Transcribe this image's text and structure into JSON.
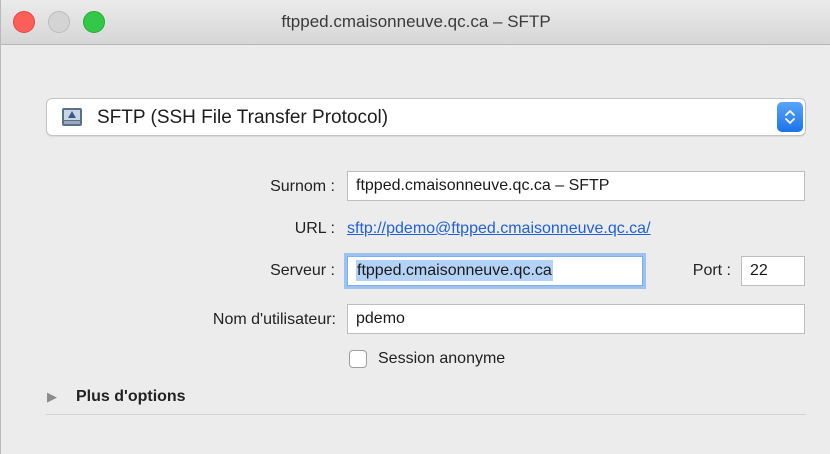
{
  "window": {
    "title": "ftpped.cmaisonneuve.qc.ca – SFTP"
  },
  "protocol": {
    "selected": "SFTP (SSH File Transfer Protocol)",
    "icon": "drive-icon"
  },
  "form": {
    "nickname_label": "Surnom :",
    "nickname_value": "ftpped.cmaisonneuve.qc.ca – SFTP",
    "url_label": "URL :",
    "url_value": "sftp://pdemo@ftpped.cmaisonneuve.qc.ca/",
    "server_label": "Serveur :",
    "server_value": "ftpped.cmaisonneuve.qc.ca",
    "port_label": "Port :",
    "port_value": "22",
    "username_label": "Nom d'utilisateur:",
    "username_value": "pdemo",
    "anonymous_label": "Session anonyme",
    "anonymous_checked": false
  },
  "more_options": {
    "label": "Plus d'options",
    "expanded": false
  },
  "colors": {
    "accent": "#1a73ea",
    "link": "#2060d8",
    "close": "#fc5f57",
    "maximize": "#34c84a",
    "focus_ring": "#5da0f2"
  }
}
